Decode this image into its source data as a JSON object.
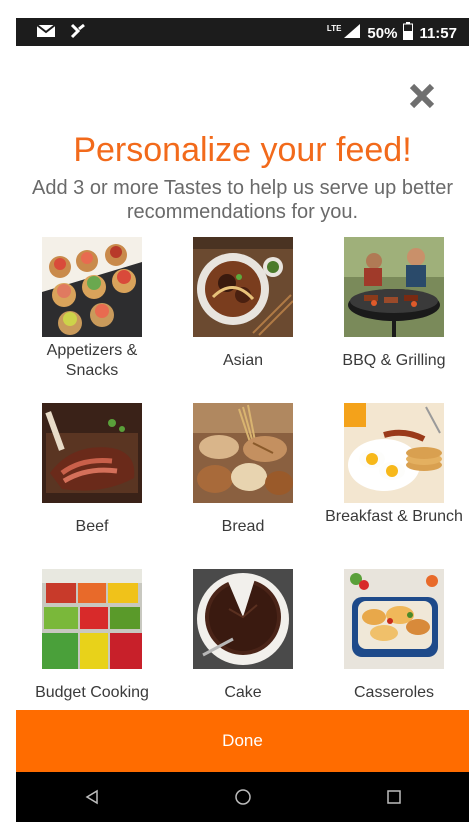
{
  "status_bar": {
    "network": "LTE",
    "battery": "50%",
    "time": "11:57"
  },
  "header": {
    "title": "Personalize your feed!",
    "subtitle": "Add 3 or more Tastes to help us serve up better recommendations for you."
  },
  "tastes": [
    {
      "label": "Appetizers & Snacks"
    },
    {
      "label": "Asian"
    },
    {
      "label": "BBQ & Grilling"
    },
    {
      "label": "Beef"
    },
    {
      "label": "Bread"
    },
    {
      "label": "Breakfast & Brunch"
    },
    {
      "label": "Budget Cooking"
    },
    {
      "label": "Cake"
    },
    {
      "label": "Casseroles"
    }
  ],
  "done_label": "Done",
  "colors": {
    "accent": "#f26a1b",
    "done_button": "#ff6c00",
    "status_bar": "#1c1c1c",
    "nav_bar": "#000000"
  }
}
